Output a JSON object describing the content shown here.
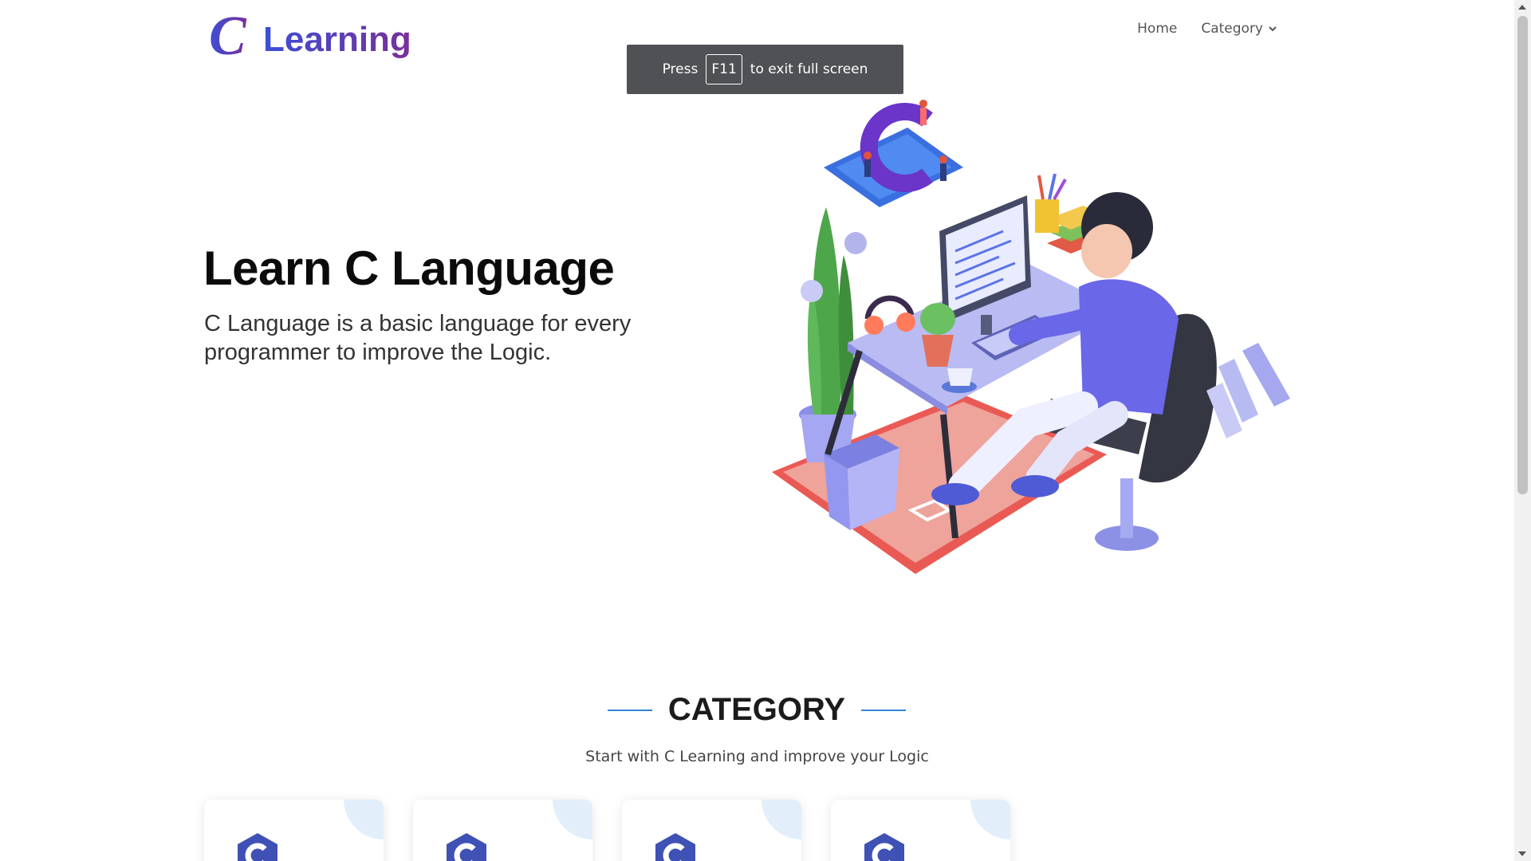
{
  "header": {
    "logo": {
      "letter": "C",
      "word": "Learning"
    },
    "nav": [
      {
        "label": "Home"
      },
      {
        "label": "Category"
      }
    ]
  },
  "fullscreen_notice": {
    "pre": "Press",
    "key": "F11",
    "post": "to exit full screen"
  },
  "hero": {
    "title": "Learn C Language",
    "subtitle": "C Language is a basic language for every programmer to improve the Logic."
  },
  "category": {
    "title": "CATEGORY",
    "subtitle": "Start with C Learning and improve your Logic",
    "cards": [
      {
        "icon": "c-language-icon"
      },
      {
        "icon": "c-language-icon"
      },
      {
        "icon": "c-language-icon"
      },
      {
        "icon": "c-language-icon"
      }
    ]
  },
  "colors": {
    "accent_line": "#2f86d6",
    "logo_gradient_start": "#3b4fd6",
    "logo_gradient_end": "#7a2f9a",
    "card_corner": "#e2effb",
    "toast_bg": "#4f5155"
  }
}
